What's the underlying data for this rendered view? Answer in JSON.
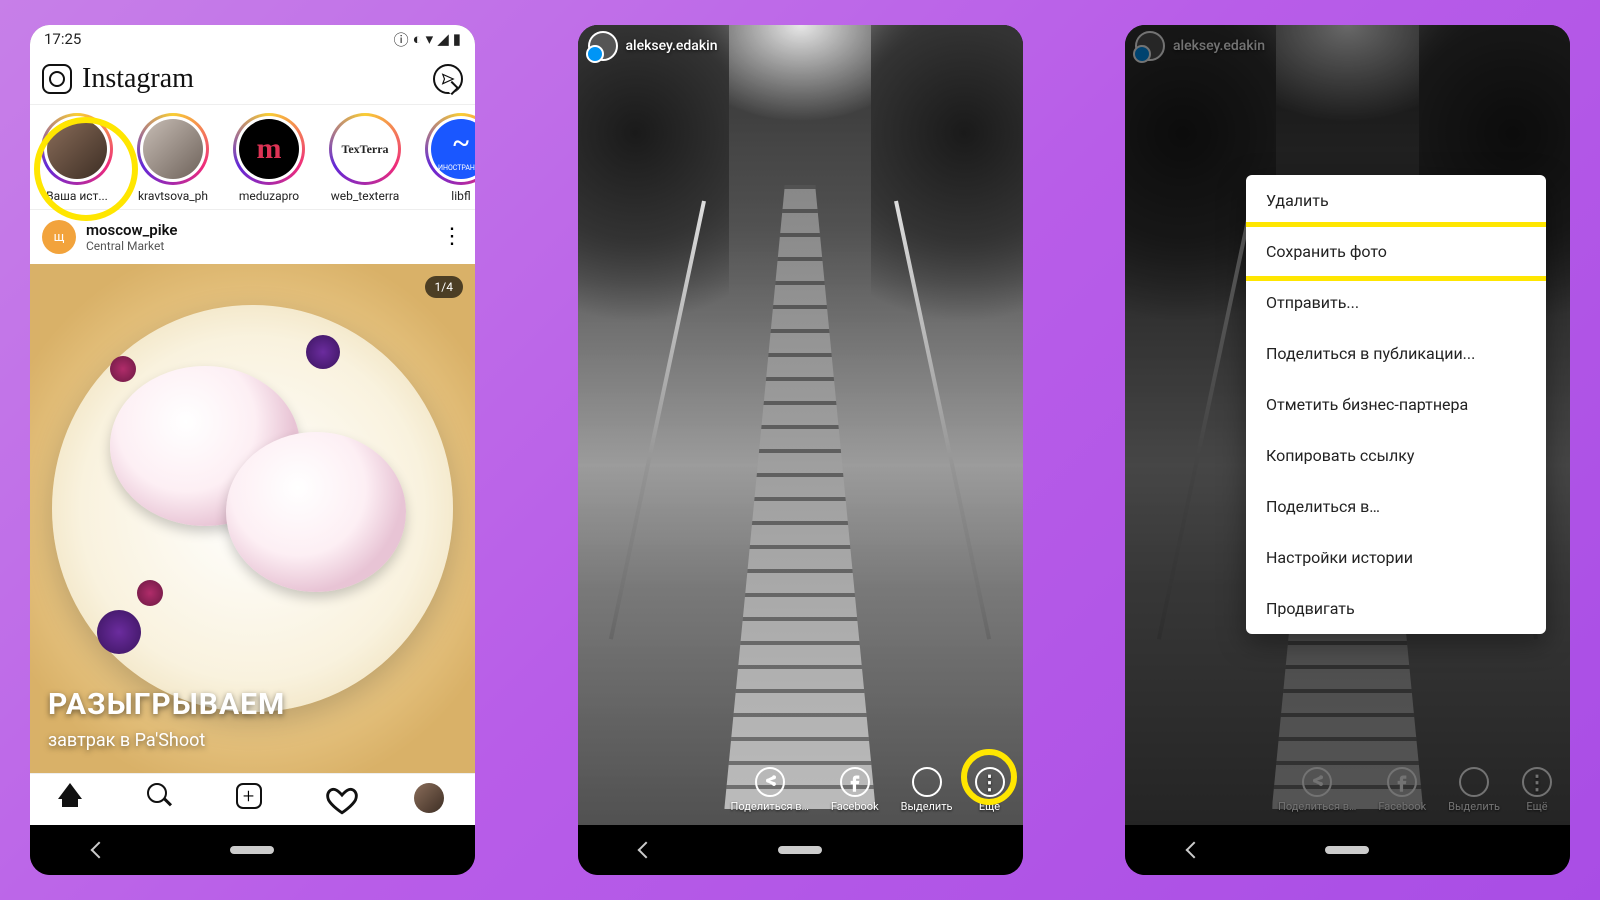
{
  "status": {
    "time": "17:25"
  },
  "header": {
    "brand": "Instagram"
  },
  "stories": [
    {
      "label": "Ваша ист...",
      "seen": false,
      "bg": "linear-gradient(135deg,#8a6d5a,#3d2e24)"
    },
    {
      "label": "kravtsova_ph",
      "seen": false,
      "bg": "linear-gradient(135deg,#c7bdb5,#6e625a)"
    },
    {
      "label": "meduzapro",
      "seen": false,
      "bg": "#000",
      "text": "m",
      "textColor": "#d35"
    },
    {
      "label": "web_texterra",
      "seen": false,
      "bg": "#fff",
      "text": "TexTerra",
      "textColor": "#222"
    },
    {
      "label": "libfl",
      "seen": false,
      "bg": "#1a57ff",
      "text": "~",
      "textColor": "#fff",
      "sub": "ИНОСТРАНКА"
    }
  ],
  "post": {
    "avatar_letter": "щ",
    "user": "moscow_pike",
    "location": "Central Market",
    "counter": "1/4",
    "caption_line1": "РАЗЫГРЫВАЕМ",
    "caption_line2": "завтрак в Pa'Shoot"
  },
  "story": {
    "user": "aleksey.edakin",
    "actions": [
      {
        "id": "share",
        "label": "Поделиться в…"
      },
      {
        "id": "facebook",
        "label": "Facebook"
      },
      {
        "id": "highlight",
        "label": "Выделить"
      },
      {
        "id": "more",
        "label": "Ещё"
      }
    ]
  },
  "menu": {
    "items": [
      "Удалить",
      "Сохранить фото",
      "Отправить...",
      "Поделиться в публикации...",
      "Отметить бизнес-партнера",
      "Копировать ссылку",
      "Поделиться в…",
      "Настройки истории",
      "Продвигать"
    ],
    "highlighted_index": 1
  }
}
